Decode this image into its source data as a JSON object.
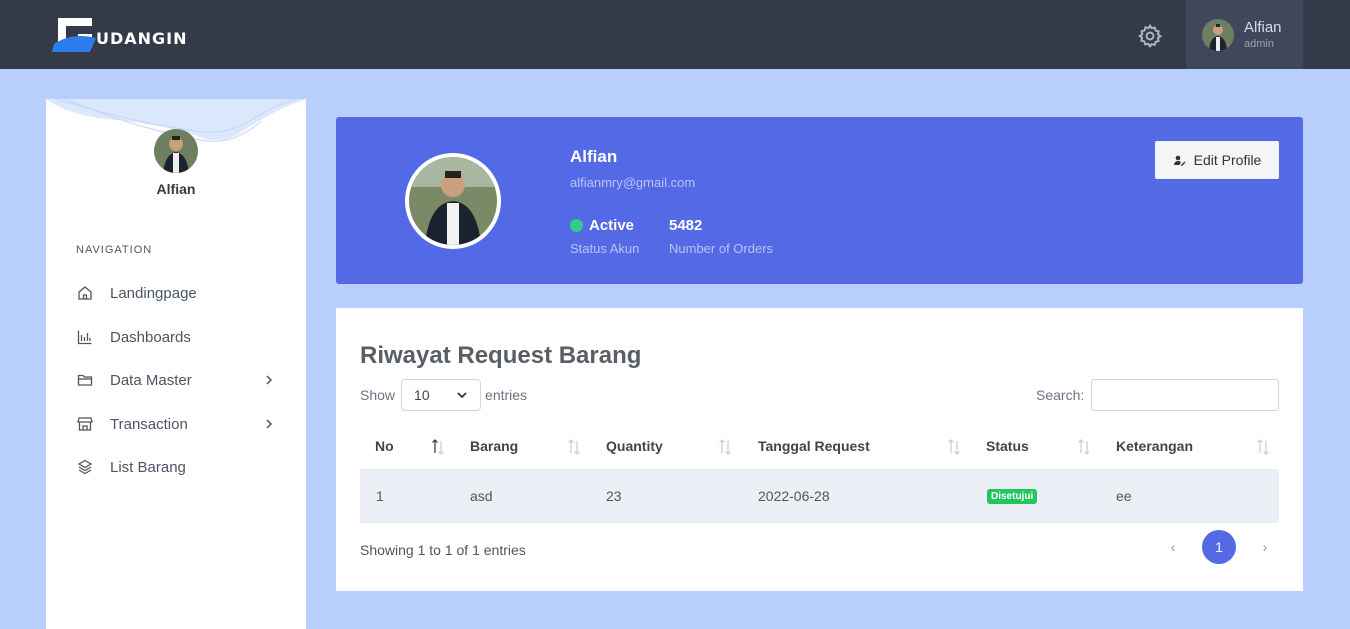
{
  "header": {
    "logo_text": "UDANGIN",
    "user_name": "Alfian",
    "user_role": "admin"
  },
  "sidebar": {
    "name": "Alfian",
    "nav_label": "NAVIGATION",
    "items": [
      {
        "label": "Landingpage",
        "icon": "home-icon"
      },
      {
        "label": "Dashboards",
        "icon": "bar-chart-icon"
      },
      {
        "label": "Data Master",
        "icon": "folder-icon",
        "has_submenu": true
      },
      {
        "label": "Transaction",
        "icon": "store-icon",
        "has_submenu": true
      },
      {
        "label": "List Barang",
        "icon": "layers-icon"
      }
    ]
  },
  "profile": {
    "name": "Alfian",
    "email": "alfianmry@gmail.com",
    "status": "Active",
    "status_label": "Status Akun",
    "orders": "5482",
    "orders_label": "Number of Orders",
    "edit_label": "Edit Profile"
  },
  "table": {
    "title": "Riwayat Request Barang",
    "show_label": "Show",
    "entries_value": "10",
    "entries_label": "entries",
    "search_label": "Search:",
    "columns": [
      "No",
      "Barang",
      "Quantity",
      "Tanggal Request",
      "Status",
      "Keterangan"
    ],
    "rows": [
      {
        "no": "1",
        "barang": "asd",
        "quantity": "23",
        "tanggal": "2022-06-28",
        "status": "Disetujui",
        "keterangan": "ee"
      }
    ],
    "info": "Showing 1 to 1 of 1 entries",
    "prev": "‹",
    "page": "1",
    "next": "›"
  },
  "colors": {
    "topbar": "#343a47",
    "accent": "#5469e5",
    "status_green": "#22c55e"
  }
}
